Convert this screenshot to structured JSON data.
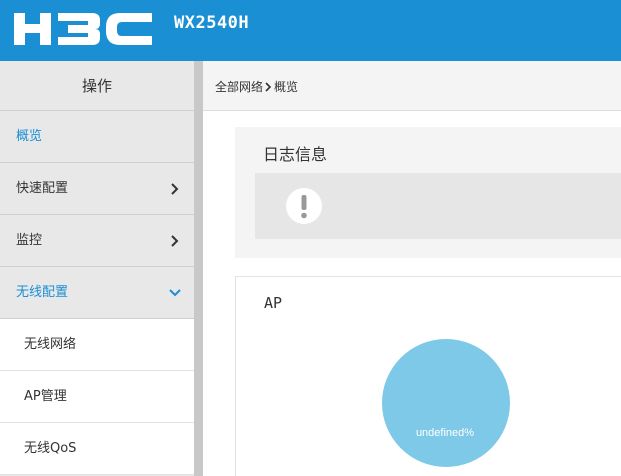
{
  "header": {
    "brand": "H3C",
    "model": "WX2540H",
    "bg_color": "#1a8fd3"
  },
  "sidebar": {
    "title": "操作",
    "items": [
      {
        "label": "概览",
        "state": "active"
      },
      {
        "label": "快速配置",
        "icon": "chevron-right-icon"
      },
      {
        "label": "监控",
        "icon": "chevron-right-icon"
      },
      {
        "label": "无线配置",
        "state": "expanded",
        "icon": "chevron-down-icon"
      }
    ],
    "subitems": [
      {
        "label": "无线网络"
      },
      {
        "label": "AP管理"
      },
      {
        "label": "无线QoS"
      }
    ]
  },
  "breadcrumb": {
    "root": "全部网络",
    "current": "概览"
  },
  "log_panel": {
    "title": "日志信息",
    "icon": "alert-icon"
  },
  "ap_panel": {
    "title": "AP",
    "chart_data": {
      "type": "pie",
      "slices": [
        {
          "label": "undefined%",
          "value": 100,
          "color": "#7ec8e8"
        }
      ]
    }
  }
}
